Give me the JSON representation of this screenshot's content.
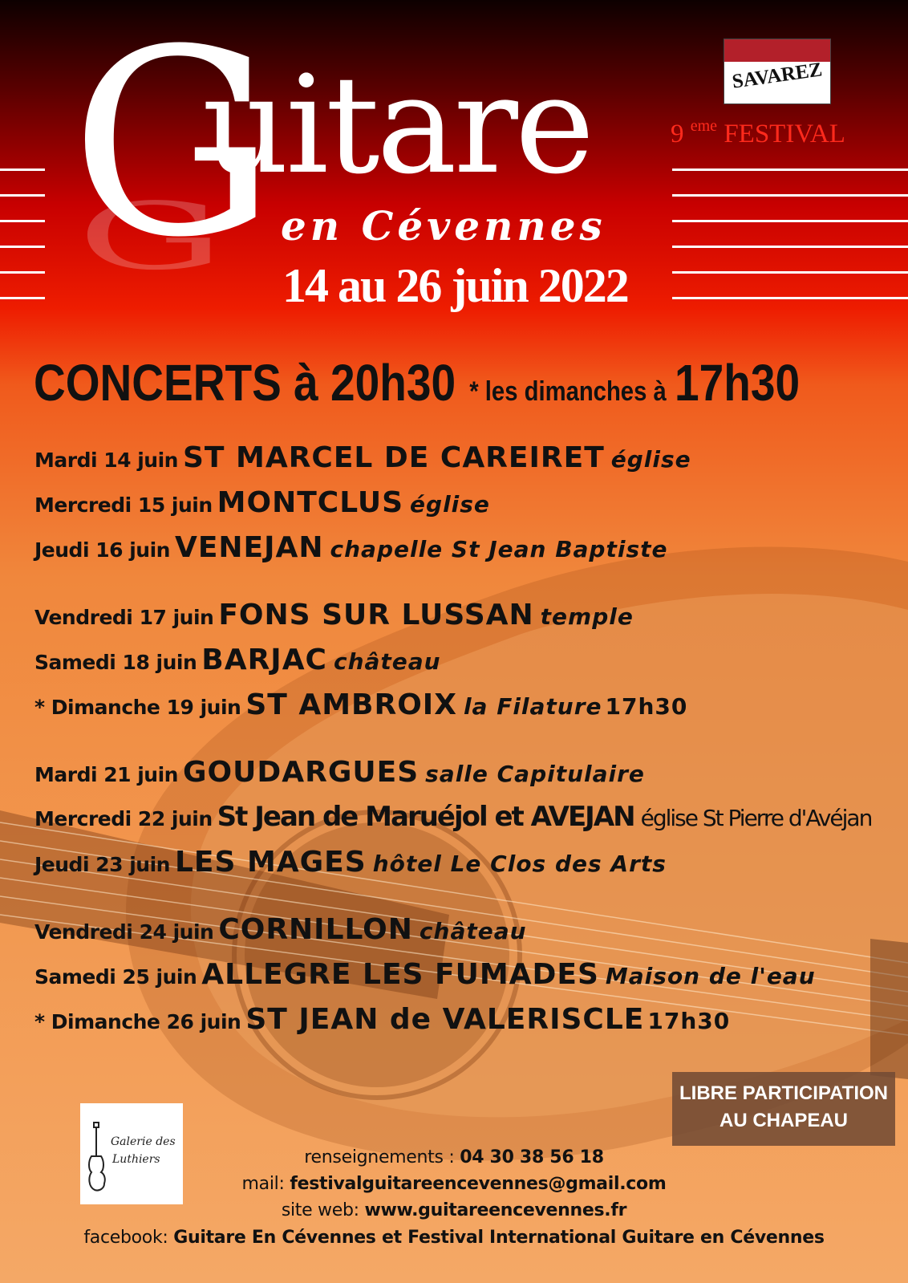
{
  "header": {
    "title_initial": "G",
    "title_rest": "uitare",
    "title_region": "en Cévennes",
    "dates": "14 au 26 juin 2022",
    "edition_number": "9",
    "edition_suffix": "eme",
    "edition_word": "FESTIVAL",
    "sponsor_logo": "SAVAREZ"
  },
  "schedule_header": {
    "concerts": "CONCERTS à 20h30",
    "sundays": "* les dimanches à",
    "sunday_time": "17h30"
  },
  "events": [
    {
      "day": "Mardi 14 juin",
      "place": "ST MARCEL DE CAREIRET",
      "venue": "église",
      "time": ""
    },
    {
      "day": "Mercredi 15 juin",
      "place": "MONTCLUS",
      "venue": "église",
      "time": ""
    },
    {
      "day": "Jeudi 16 juin",
      "place": "VENEJAN",
      "venue": "chapelle St Jean Baptiste",
      "time": ""
    },
    {
      "day": "Vendredi 17 juin",
      "place": "FONS SUR LUSSAN",
      "venue": "temple",
      "time": ""
    },
    {
      "day": "Samedi 18 juin",
      "place": "BARJAC",
      "venue": "château",
      "time": ""
    },
    {
      "day": "* Dimanche 19 juin",
      "place": "ST AMBROIX",
      "venue": "la Filature",
      "time": "17h30"
    },
    {
      "day": "Mardi 21 juin",
      "place": "GOUDARGUES",
      "venue": "salle Capitulaire",
      "time": ""
    },
    {
      "day": "Mercredi 22 juin",
      "place": "St Jean de Maruéjol et AVEJAN",
      "venue": "église St Pierre d'Avéjan",
      "time": ""
    },
    {
      "day": "Jeudi 23 juin",
      "place": "LES MAGES",
      "venue": "hôtel Le Clos des Arts",
      "time": ""
    },
    {
      "day": "Vendredi 24 juin",
      "place": "CORNILLON",
      "venue": "château",
      "time": ""
    },
    {
      "day": "Samedi 25 juin",
      "place": "ALLEGRE LES FUMADES",
      "venue": "Maison de l'eau",
      "time": ""
    },
    {
      "day": "* Dimanche 26 juin",
      "place": "ST JEAN de VALERISCLE",
      "venue": "",
      "time": "17h30"
    }
  ],
  "participation": {
    "line1": "LIBRE PARTICIPATION",
    "line2": "AU CHAPEAU"
  },
  "lutherie_logo": {
    "line1": "Galerie des",
    "line2": "Luthiers"
  },
  "contact": {
    "info_label": "renseignements :",
    "phone": "04 30 38 56 18",
    "mail_label": "mail:",
    "email": "festivalguitareencevennes@gmail.com",
    "site_label": "site web:",
    "website": "www.guitareencevennes.fr",
    "facebook_label": "facebook:",
    "facebook": "Guitare En Cévennes et Festival International Guitare en Cévennes"
  },
  "colors": {
    "edition_red": "#ff2a1c",
    "box_brown": "#734b34",
    "text": "#111111"
  }
}
